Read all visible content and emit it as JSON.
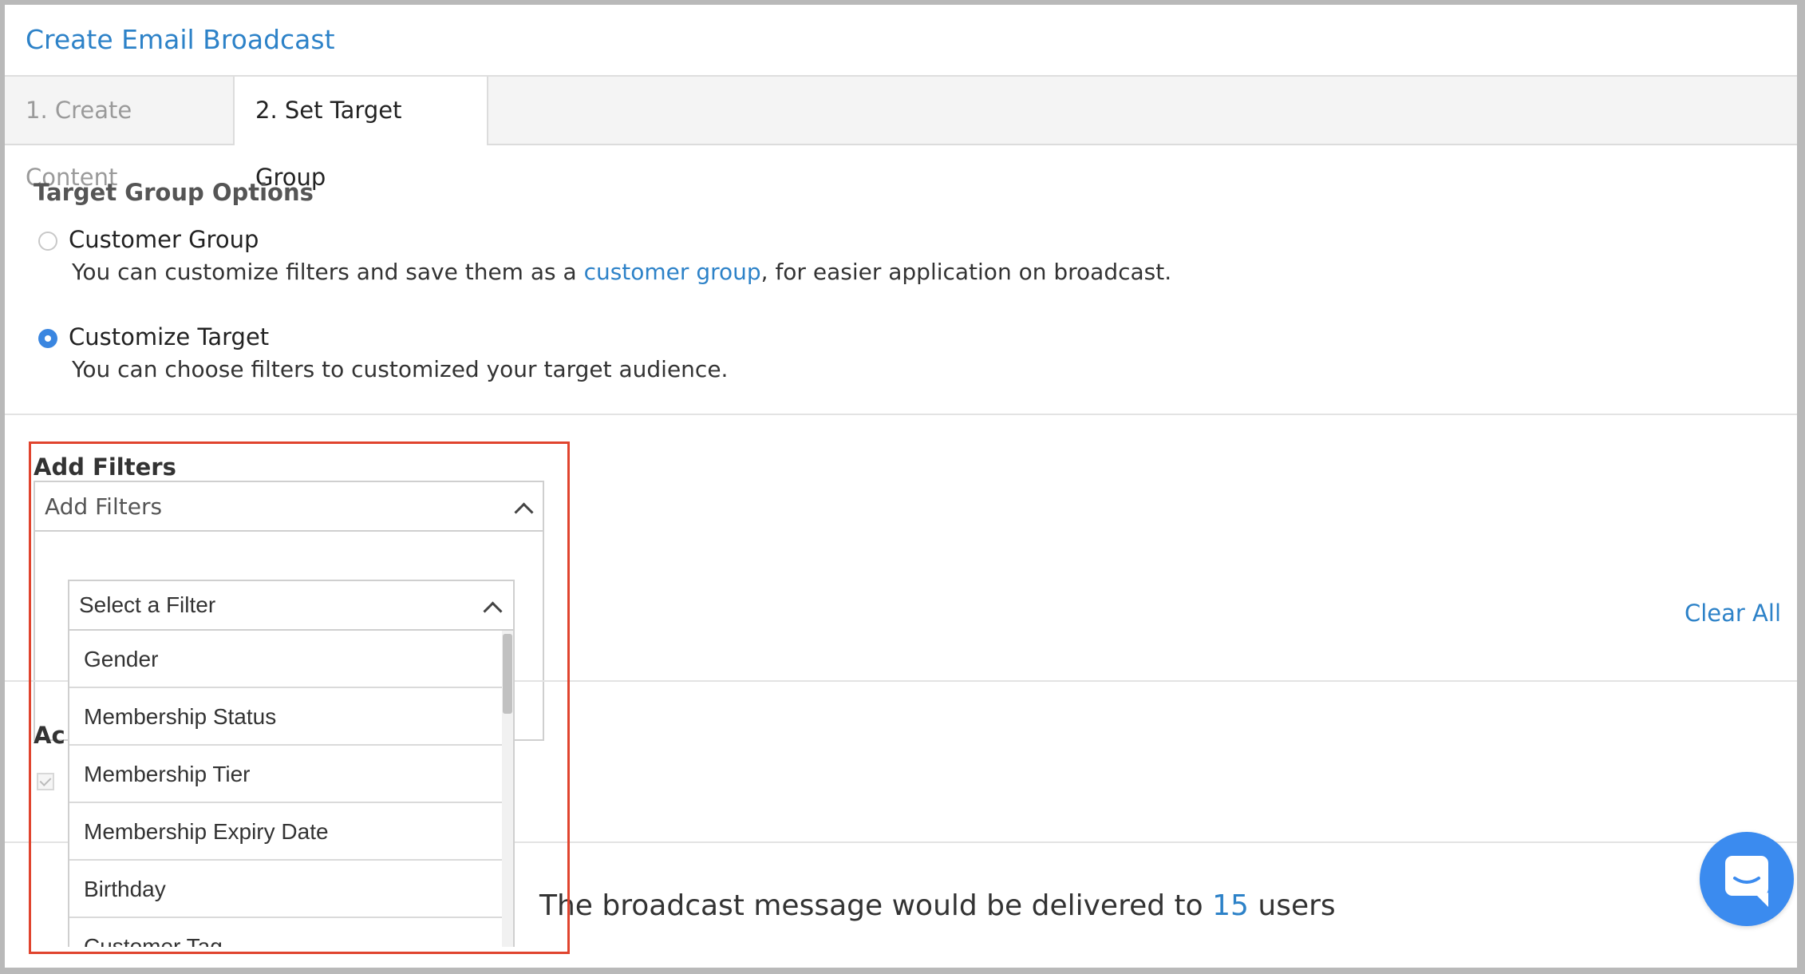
{
  "header": {
    "title": "Create Email Broadcast"
  },
  "tabs": [
    {
      "label": "1. Create Content",
      "active": false
    },
    {
      "label": "2. Set Target Group",
      "active": true
    }
  ],
  "target_options": {
    "title": "Target Group Options",
    "customer_group": {
      "label": "Customer Group",
      "selected": false,
      "desc_before": "You can customize filters and save them as a ",
      "desc_link": "customer group",
      "desc_after": ", for easier application on broadcast."
    },
    "customize_target": {
      "label": "Customize Target",
      "selected": true,
      "desc": "You can choose filters to customized your target audience."
    }
  },
  "filters": {
    "label": "Add Filters",
    "select_placeholder": "Add Filters",
    "filter_select_placeholder": "Select a Filter",
    "options": [
      "Gender",
      "Membership Status",
      "Membership Tier",
      "Membership Expiry Date",
      "Birthday",
      "Customer Tag"
    ],
    "clear_all": "Clear All"
  },
  "summary": {
    "prefix": "The broadcast message would be delivered to ",
    "count": "15",
    "suffix": " users"
  },
  "colors": {
    "accent": "#2d82c8",
    "highlight": "#e0442e",
    "chat": "#3b8bef"
  },
  "icons": [
    "chevron-up-icon",
    "chat-icon",
    "check-icon"
  ]
}
